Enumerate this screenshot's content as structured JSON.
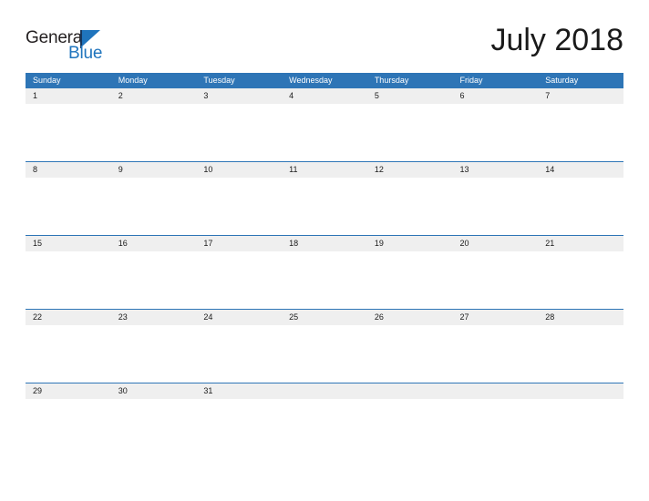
{
  "brand": {
    "logo_text_top": "General",
    "logo_text_bottom": "Blue",
    "logo_icon": "flag-triangle-icon",
    "color_blue": "#1f74bd",
    "color_dark": "#231f20"
  },
  "header": {
    "title": "July 2018"
  },
  "calendar": {
    "accent_color": "#2e75b6",
    "cell_band_color": "#efefef",
    "weekday_headers": [
      "Sunday",
      "Monday",
      "Tuesday",
      "Wednesday",
      "Thursday",
      "Friday",
      "Saturday"
    ],
    "weeks": [
      {
        "days": [
          "1",
          "2",
          "3",
          "4",
          "5",
          "6",
          "7"
        ]
      },
      {
        "days": [
          "8",
          "9",
          "10",
          "11",
          "12",
          "13",
          "14"
        ]
      },
      {
        "days": [
          "15",
          "16",
          "17",
          "18",
          "19",
          "20",
          "21"
        ]
      },
      {
        "days": [
          "22",
          "23",
          "24",
          "25",
          "26",
          "27",
          "28"
        ]
      },
      {
        "days": [
          "29",
          "30",
          "31",
          "",
          "",
          "",
          ""
        ]
      }
    ]
  }
}
